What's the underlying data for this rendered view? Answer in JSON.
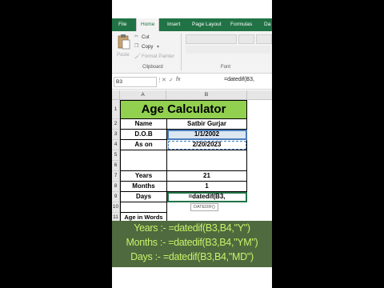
{
  "ribbon": {
    "tabs": [
      "File",
      "Home",
      "Insert",
      "Page Layout",
      "Formulas",
      "Da"
    ],
    "active_tab": "Home",
    "clipboard": {
      "cut": "Cut",
      "copy": "Copy",
      "format_painter": "Format Painter",
      "paste": "Paste",
      "group_label": "Clipboard"
    },
    "font_group_label": "Font"
  },
  "formula_bar": {
    "name_box": "B3",
    "fx": "fx",
    "formula": "=datedif(B3,"
  },
  "columns": [
    "A",
    "B"
  ],
  "rows": [
    "1",
    "2",
    "3",
    "4",
    "5",
    "6",
    "7",
    "8",
    "9",
    "10",
    "11"
  ],
  "sheet": {
    "title": "Age Calculator",
    "name_label": "Name",
    "name_value": "Satbir Gurjar",
    "dob_label": "D.O.B",
    "dob_value": "1/1/2002",
    "ason_label": "As on",
    "ason_value": "2/20/2023",
    "years_label": "Years",
    "years_value": "21",
    "months_label": "Months",
    "months_value": "1",
    "days_label": "Days",
    "days_value": "=datedif(B3,",
    "age_words_label": "Age in Words",
    "tooltip": "DATEDIF()"
  },
  "overlay": {
    "line1": "Years :- =datedif(B3,B4,\"Y\")",
    "line2": "Months :- =datedif(B3,B4,\"YM\")",
    "line3": "Days :- =datedif(B3,B4,\"MD\")"
  },
  "colors": {
    "excel_green": "#217346",
    "title_fill": "#92d050",
    "overlay_bg": "#4f6a3e",
    "overlay_text": "#c6f26a"
  }
}
